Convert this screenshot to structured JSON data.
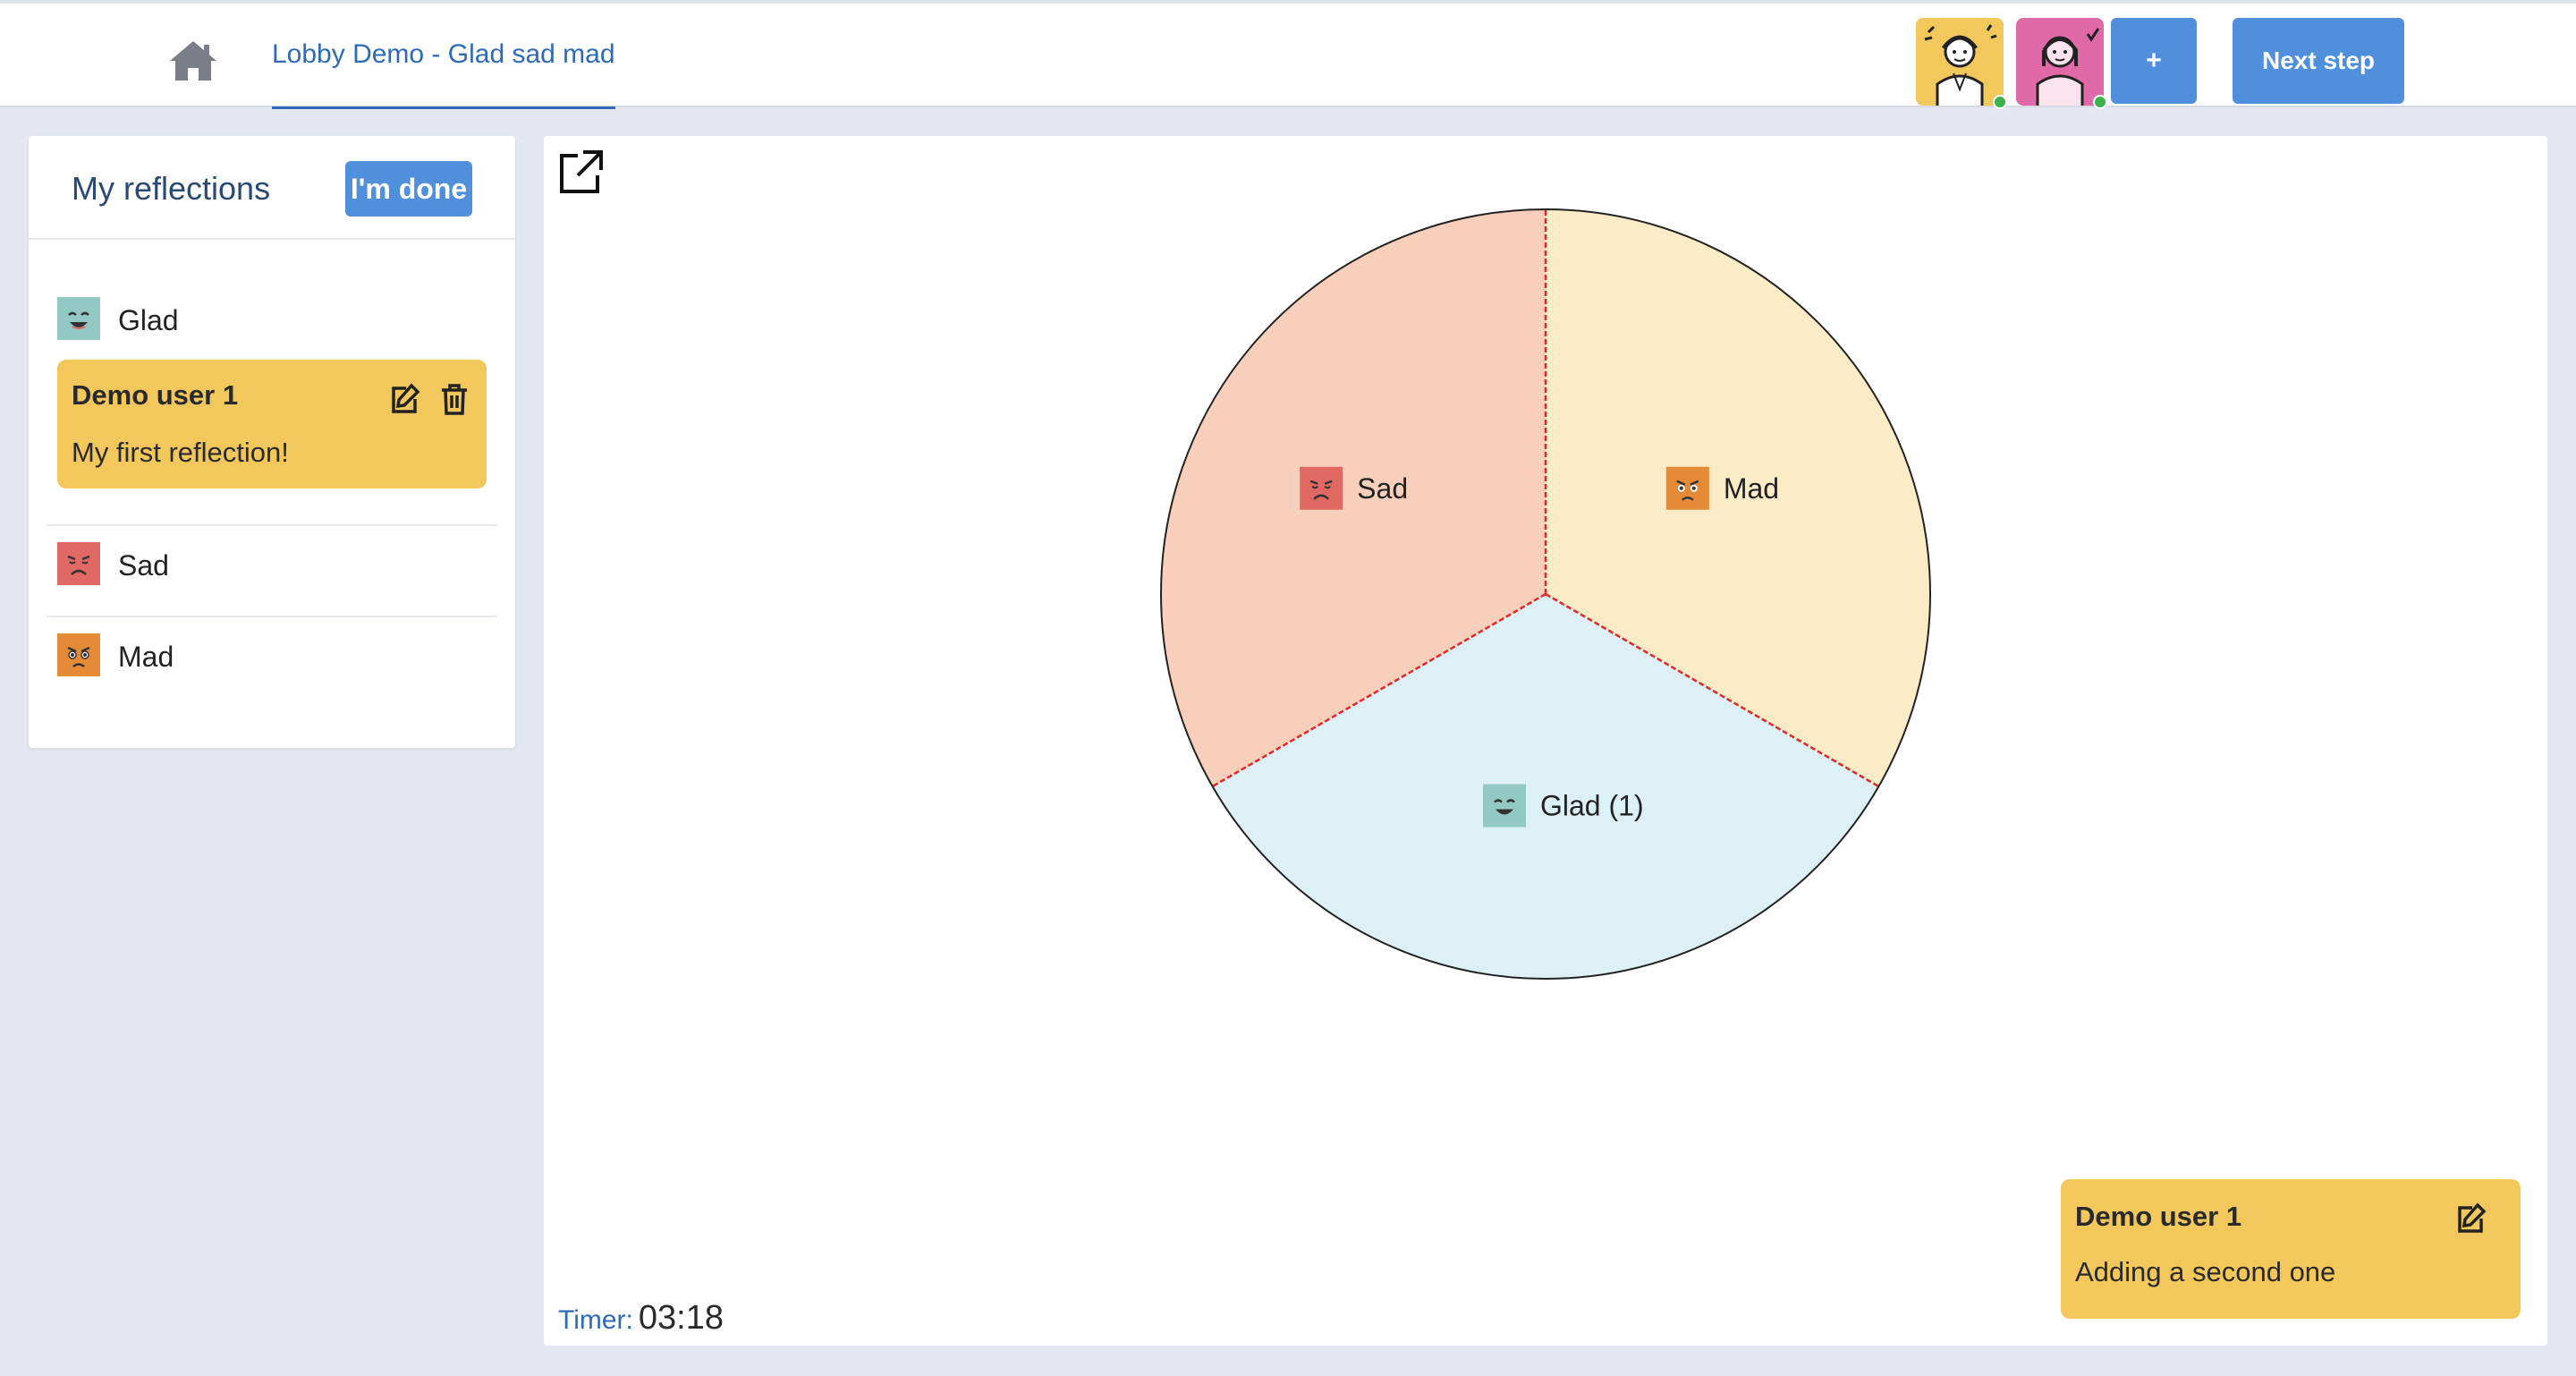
{
  "header": {
    "home_icon": "home-icon",
    "breadcrumb": "Lobby Demo - Glad sad mad",
    "participants": [
      {
        "avatar": "user-avatar-yellow",
        "color": "#f2c85d",
        "online": true
      },
      {
        "avatar": "user-avatar-pink",
        "color": "#e06aa7",
        "online": true
      }
    ],
    "add_label": "+",
    "next_label": "Next step"
  },
  "sidebar": {
    "title": "My reflections",
    "done_label": "I'm done",
    "categories": [
      {
        "label": "Glad",
        "icon": "happy-face-icon",
        "color": "#93c9c4"
      },
      {
        "label": "Sad",
        "icon": "sad-face-icon",
        "color": "#e06a63"
      },
      {
        "label": "Mad",
        "icon": "angry-face-icon",
        "color": "#e58a37"
      }
    ],
    "notes": [
      {
        "author": "Demo user 1",
        "text": "My first reflection!",
        "color": "#f2c85d"
      }
    ]
  },
  "board": {
    "expand_icon": "external-link-icon",
    "timer_label": "Timer:",
    "timer_value": "03:18",
    "floating_note": {
      "author": "Demo user 1",
      "text": "Adding a second one",
      "color": "#f2c85d"
    }
  },
  "chart_data": {
    "type": "pie",
    "slices": [
      {
        "label": "Mad",
        "value": 1,
        "color": "#fbebc7",
        "icon": "angry-face-icon"
      },
      {
        "label": "Glad (1)",
        "value": 1,
        "color": "#dcf0f6",
        "icon": "happy-face-icon"
      },
      {
        "label": "Sad",
        "value": 1,
        "color": "#f8cfba",
        "icon": "sad-face-icon"
      }
    ],
    "divider_color": "#e02b2b"
  }
}
